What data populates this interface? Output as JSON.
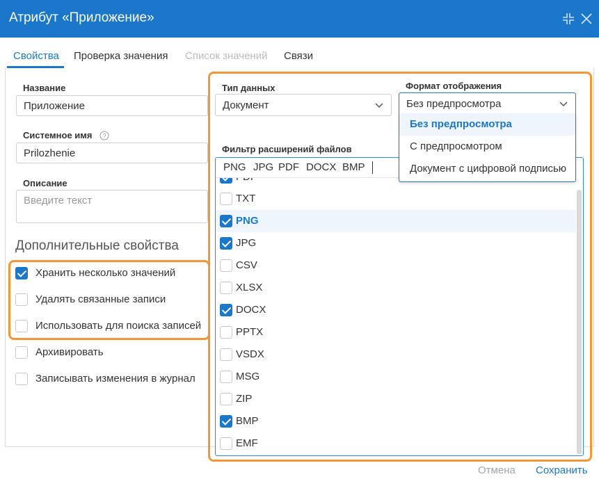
{
  "dialog": {
    "title": "Атрибут «Приложение»",
    "accent_color": "#1a77c9",
    "highlight_color": "#f39636",
    "icons": [
      "collapse-icon",
      "close-icon"
    ]
  },
  "tabs": [
    {
      "label": "Свойства",
      "state": "active"
    },
    {
      "label": "Проверка значения",
      "state": "normal"
    },
    {
      "label": "Список значений",
      "state": "disabled"
    },
    {
      "label": "Связи",
      "state": "normal"
    }
  ],
  "form": {
    "name_label": "Название",
    "name_value": "Приложение",
    "system_name_label": "Системное имя",
    "system_name_value": "Prilozhenie",
    "description_label": "Описание",
    "description_placeholder": "Введите текст",
    "data_type_label": "Тип данных",
    "data_type_value": "Документ",
    "display_format_label": "Формат отображения",
    "display_format_value": "Без предпросмотра",
    "filter_label": "Фильтр расширений файлов"
  },
  "additional": {
    "title": "Дополнительные свойства",
    "options": [
      {
        "label": "Хранить несколько значений",
        "checked": true
      },
      {
        "label": "Удалять связанные записи",
        "checked": false
      },
      {
        "label": "Использовать для поиска записей",
        "checked": false
      },
      {
        "label": "Архивировать",
        "checked": false
      },
      {
        "label": "Записывать изменения в журнал",
        "checked": false
      }
    ]
  },
  "display_format_options": [
    {
      "label": "Без предпросмотра",
      "selected": true
    },
    {
      "label": "С предпросмотром",
      "selected": false
    },
    {
      "label": "Документ с цифровой подписью",
      "selected": false
    }
  ],
  "filter": {
    "tags": [
      "PNG",
      "JPG",
      "PDF",
      "DOCX",
      "BMP"
    ],
    "partial_item": {
      "label": "PDF",
      "checked": true
    },
    "items": [
      {
        "label": "TXT",
        "checked": false
      },
      {
        "label": "PNG",
        "checked": true,
        "highlighted": true
      },
      {
        "label": "JPG",
        "checked": true
      },
      {
        "label": "CSV",
        "checked": false
      },
      {
        "label": "XLSX",
        "checked": false
      },
      {
        "label": "DOCX",
        "checked": true
      },
      {
        "label": "PPTX",
        "checked": false
      },
      {
        "label": "VSDX",
        "checked": false
      },
      {
        "label": "MSG",
        "checked": false
      },
      {
        "label": "ZIP",
        "checked": false
      },
      {
        "label": "BMP",
        "checked": true
      },
      {
        "label": "EMF",
        "checked": false
      }
    ]
  },
  "footer": {
    "cancel_label": "Отмена",
    "save_label": "Сохранить"
  }
}
